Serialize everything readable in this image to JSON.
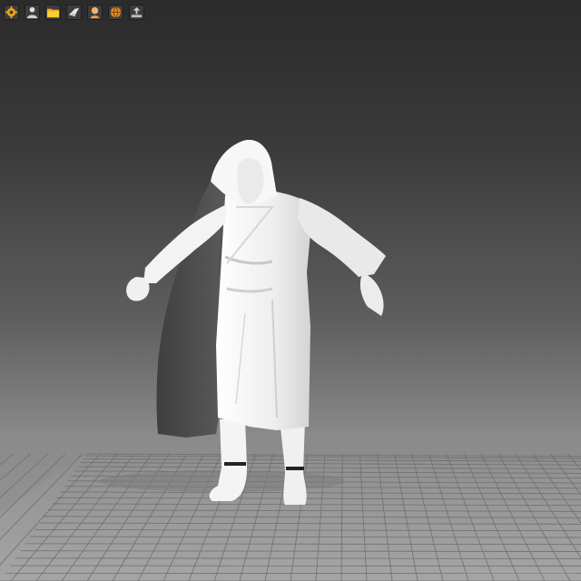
{
  "toolbar": {
    "buttons": [
      {
        "icon": "gear-icon"
      },
      {
        "icon": "user-icon"
      },
      {
        "icon": "folder-icon"
      },
      {
        "icon": "bird-icon"
      },
      {
        "icon": "avatar-icon"
      },
      {
        "icon": "globe-icon"
      },
      {
        "icon": "export-icon"
      }
    ]
  },
  "viewport": {
    "subject": "3d-character-model",
    "floor_grid": true,
    "colors": {
      "model": "#f2f2f2",
      "cloak_inner": "#4a4a4a",
      "grid_line": "#6f6f6f",
      "floor": "#9c9c9c"
    }
  }
}
